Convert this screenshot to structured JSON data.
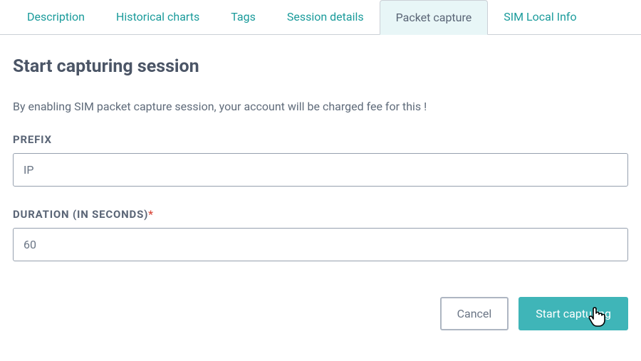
{
  "tabs": [
    {
      "label": "Description",
      "active": false
    },
    {
      "label": "Historical charts",
      "active": false
    },
    {
      "label": "Tags",
      "active": false
    },
    {
      "label": "Session details",
      "active": false
    },
    {
      "label": "Packet capture",
      "active": true
    },
    {
      "label": "SIM Local Info",
      "active": false
    }
  ],
  "page": {
    "title": "Start capturing session",
    "description": "By enabling SIM packet capture session, your account will be charged fee for this !"
  },
  "fields": {
    "prefix": {
      "label": "PREFIX",
      "value": "IP",
      "required": false
    },
    "duration": {
      "label": "DURATION (IN SECONDS)",
      "value": "60",
      "required": true
    }
  },
  "buttons": {
    "cancel": "Cancel",
    "start": "Start capturing"
  },
  "required_mark": "*"
}
